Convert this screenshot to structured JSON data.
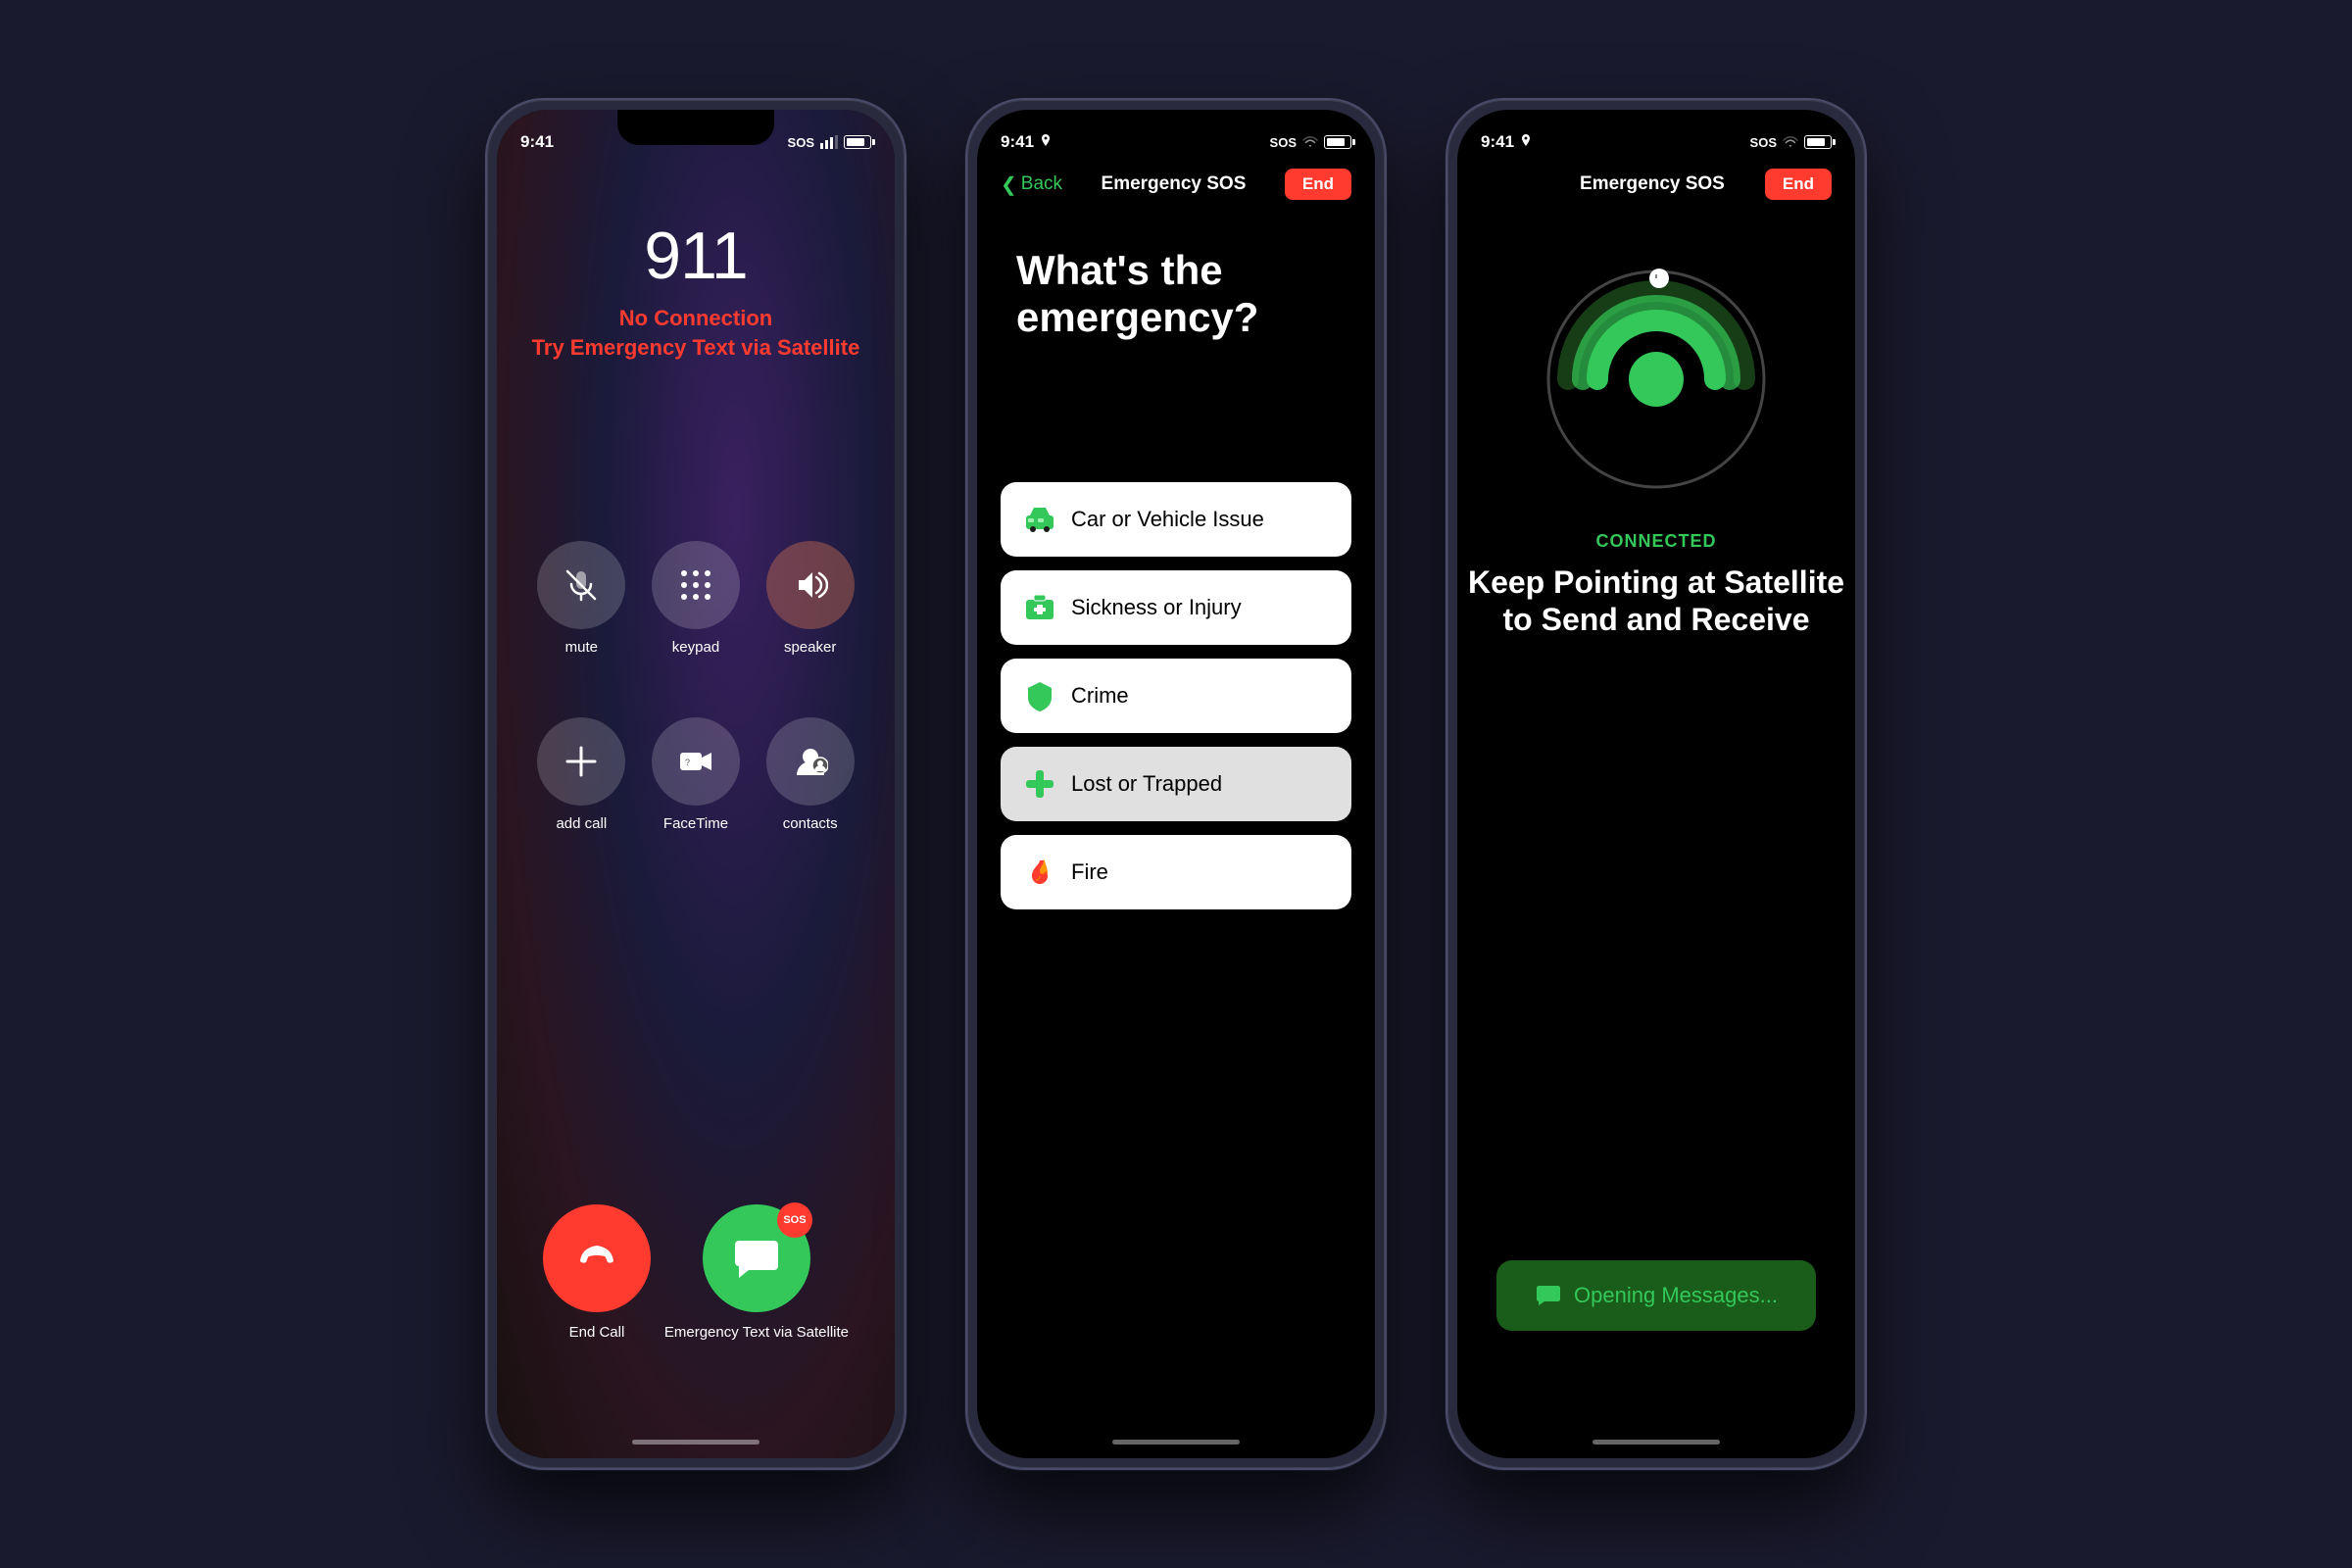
{
  "background": "#1a1a2e",
  "phone1": {
    "status_bar": {
      "time": "9:41",
      "signal": "SOS",
      "battery_level": 80
    },
    "number": "911",
    "no_connection": "No Connection",
    "try_satellite": "Try Emergency Text via Satellite",
    "controls": [
      {
        "id": "mute",
        "label": "mute",
        "icon": "mic-slash"
      },
      {
        "id": "keypad",
        "label": "keypad",
        "icon": "keypad"
      },
      {
        "id": "speaker",
        "label": "speaker",
        "icon": "speaker",
        "active": true
      }
    ],
    "controls2": [
      {
        "id": "add-call",
        "label": "add call",
        "icon": "plus"
      },
      {
        "id": "facetime",
        "label": "FaceTime",
        "icon": "facetime"
      },
      {
        "id": "contacts",
        "label": "contacts",
        "icon": "contacts"
      }
    ],
    "end_call_label": "End Call",
    "sos_label": "Emergency Text via Satellite",
    "sos_badge": "SOS"
  },
  "phone2": {
    "status_bar": {
      "time": "9:41",
      "signal": "SOS",
      "battery_level": 80
    },
    "back_label": "Back",
    "nav_title": "Emergency SOS",
    "end_label": "End",
    "question": "What's the emergency?",
    "options": [
      {
        "id": "car",
        "label": "Car or Vehicle Issue",
        "icon": "🚗",
        "icon_color": "#34c759",
        "selected": false
      },
      {
        "id": "sickness",
        "label": "Sickness or Injury",
        "icon": "🏥",
        "icon_color": "#34c759",
        "selected": false
      },
      {
        "id": "crime",
        "label": "Crime",
        "icon": "🛡",
        "icon_color": "#34c759",
        "selected": false
      },
      {
        "id": "lost",
        "label": "Lost or Trapped",
        "icon": "✚",
        "icon_color": "#34c759",
        "selected": true
      },
      {
        "id": "fire",
        "label": "Fire",
        "icon": "🔥",
        "icon_color": "#34c759",
        "selected": false
      }
    ]
  },
  "phone3": {
    "status_bar": {
      "time": "9:41",
      "signal": "SOS",
      "battery_level": 80
    },
    "nav_title": "Emergency SOS",
    "end_label": "End",
    "connected_label": "CONNECTED",
    "connected_subtitle": "Keep Pointing at Satellite\nto Send and Receive",
    "connected_subtitle_line1": "Keep Pointing at Satellite",
    "connected_subtitle_line2": "to Send and Receive",
    "opening_messages": "Opening Messages..."
  }
}
